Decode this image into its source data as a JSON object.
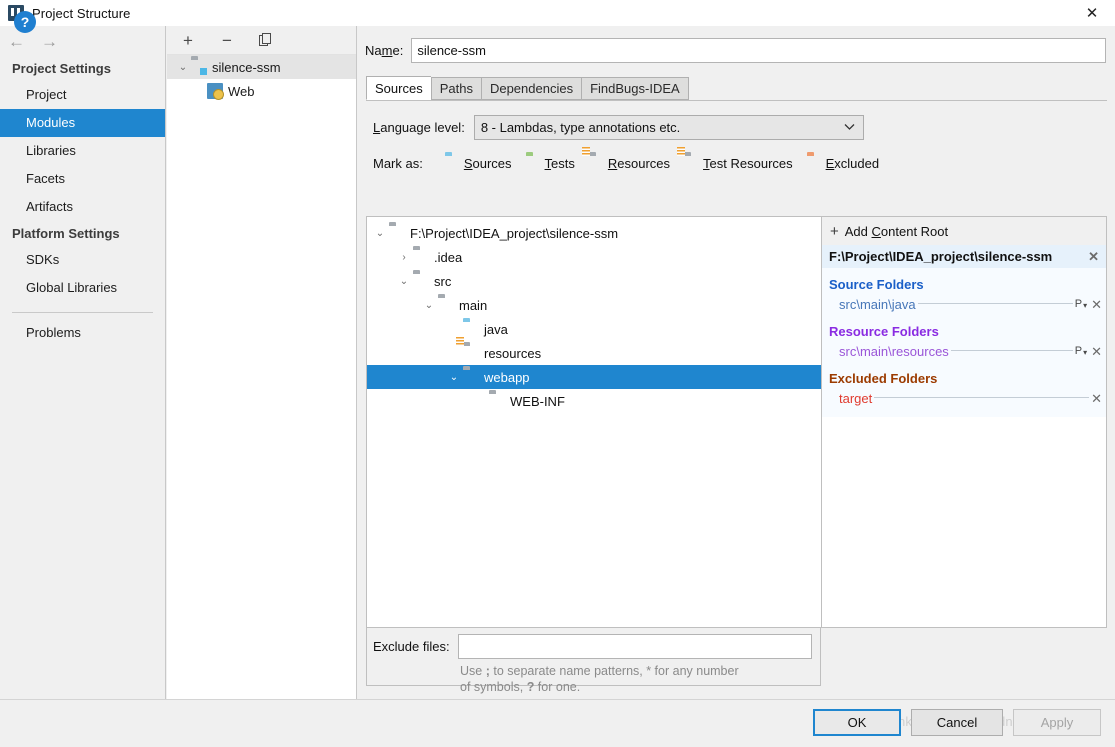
{
  "window": {
    "title": "Project Structure",
    "app_icon": "intellij-idea-icon",
    "close_label": "✕"
  },
  "nav": {
    "back_icon": "←",
    "forward_icon": "→"
  },
  "sidebar": {
    "groups": [
      {
        "title": "Project Settings",
        "items": [
          {
            "label": "Project",
            "selected": false
          },
          {
            "label": "Modules",
            "selected": true
          },
          {
            "label": "Libraries",
            "selected": false
          },
          {
            "label": "Facets",
            "selected": false
          },
          {
            "label": "Artifacts",
            "selected": false
          }
        ]
      },
      {
        "title": "Platform Settings",
        "items": [
          {
            "label": "SDKs",
            "selected": false
          },
          {
            "label": "Global Libraries",
            "selected": false
          }
        ]
      }
    ],
    "problems": {
      "label": "Problems",
      "selected": false
    }
  },
  "modules_panel": {
    "toolbar": {
      "add_label": "+",
      "remove_label": "−",
      "copy_label": "copy"
    },
    "tree": [
      {
        "label": "silence-ssm",
        "caret": "⌄",
        "icon": "module-folder-icon",
        "selected_bg": true,
        "indent": 0
      },
      {
        "label": "Web",
        "caret": "",
        "icon": "web-facet-icon",
        "selected_bg": false,
        "indent": 1
      }
    ]
  },
  "main": {
    "name_label": "Name:",
    "name_label_prefix": "Na",
    "name_label_mnemonic": "m",
    "name_label_suffix": "e:",
    "name_value": "silence-ssm",
    "tabs": [
      {
        "label": "Sources",
        "active": true
      },
      {
        "label": "Paths",
        "active": false
      },
      {
        "label": "Dependencies",
        "active": false
      },
      {
        "label": "FindBugs-IDEA",
        "active": false
      }
    ],
    "language_level": {
      "label": "Language level:",
      "label_mnemonic": "L",
      "label_rest": "anguage level:",
      "value": "8 - Lambdas, type annotations etc.",
      "chevron": "⌄"
    },
    "mark_as": {
      "label": "Mark as:",
      "buttons": [
        {
          "label": "Sources",
          "mnemonic": "S",
          "rest": "ources",
          "icon": "sources-folder-icon",
          "color": "#7ec7e8"
        },
        {
          "label": "Tests",
          "mnemonic": "T",
          "rest": "ests",
          "icon": "tests-folder-icon",
          "color": "#9ccb7e"
        },
        {
          "label": "Resources",
          "mnemonic": "R",
          "rest": "esources",
          "icon": "resources-folder-icon",
          "color": "#a4aab0"
        },
        {
          "label": "Test Resources",
          "mnemonic": "T",
          "rest": "est Resources",
          "icon": "test-resources-folder-icon",
          "color": "#a4aab0"
        },
        {
          "label": "Excluded",
          "mnemonic": "E",
          "rest": "xcluded",
          "icon": "excluded-folder-icon",
          "color": "#ef9b6e"
        }
      ]
    },
    "file_tree": [
      {
        "label": "F:\\Project\\IDEA_project\\silence-ssm",
        "caret": "⌄",
        "icon": "folder-icon",
        "depth": 0,
        "selected": false
      },
      {
        "label": ".idea",
        "caret": "›",
        "icon": "folder-icon",
        "depth": 1,
        "selected": false
      },
      {
        "label": "src",
        "caret": "⌄",
        "icon": "folder-icon",
        "depth": 1,
        "selected": false
      },
      {
        "label": "main",
        "caret": "⌄",
        "icon": "folder-icon",
        "depth": 2,
        "selected": false
      },
      {
        "label": "java",
        "caret": "",
        "icon": "sources-folder-icon",
        "depth": 3,
        "selected": false
      },
      {
        "label": "resources",
        "caret": "",
        "icon": "resources-folder-icon",
        "depth": 3,
        "selected": false
      },
      {
        "label": "webapp",
        "caret": "⌄",
        "icon": "folder-icon",
        "depth": 3,
        "selected": true
      },
      {
        "label": "WEB-INF",
        "caret": "",
        "icon": "folder-icon",
        "depth": 4,
        "selected": false
      }
    ],
    "content_roots": {
      "add_label": "Add Content Root",
      "add_label_prefix": "Add ",
      "add_label_mnemonic": "C",
      "add_label_rest": "ontent Root",
      "add_icon": "+",
      "root_path": "F:\\Project\\IDEA_project\\silence-ssm",
      "root_close_icon": "✕",
      "categories": [
        {
          "title": "Source Folders",
          "color": "#1a5fc8",
          "entries": [
            {
              "path": "src\\main\\java",
              "has_package_prefix": true,
              "package_prefix_icon": "P",
              "close_icon": "✕"
            }
          ]
        },
        {
          "title": "Resource Folders",
          "color": "#8a2be2",
          "entries": [
            {
              "path": "src\\main\\resources",
              "has_package_prefix": true,
              "package_prefix_icon": "P",
              "close_icon": "✕"
            }
          ]
        },
        {
          "title": "Excluded Folders",
          "color": "#9c3b00",
          "entries": [
            {
              "path": "target",
              "has_package_prefix": false,
              "package_prefix_icon": "",
              "close_icon": "✕"
            }
          ]
        }
      ]
    },
    "exclude_files": {
      "label": "Exclude files:",
      "value": "",
      "placeholder": "",
      "hint_line1_a": "Use ",
      "hint_line1_semicolon": ";",
      "hint_line1_b": " to separate name patterns, * for any number",
      "hint_line2_a": "of symbols, ",
      "hint_line2_question": "?",
      "hint_line2_b": " for one."
    }
  },
  "footer": {
    "help_label": "?",
    "ok_label": "OK",
    "cancel_label": "Cancel",
    "apply_label": "Apply",
    "watermark": "https://thinkingcao.blog.csdn.net"
  },
  "colors": {
    "accent_blue": "#1f86cf",
    "window_bg": "#f0f0f0",
    "panel_bg": "#ffffff",
    "root_header_bg": "#e6f1fb",
    "root_body_bg": "#f7fbff"
  }
}
